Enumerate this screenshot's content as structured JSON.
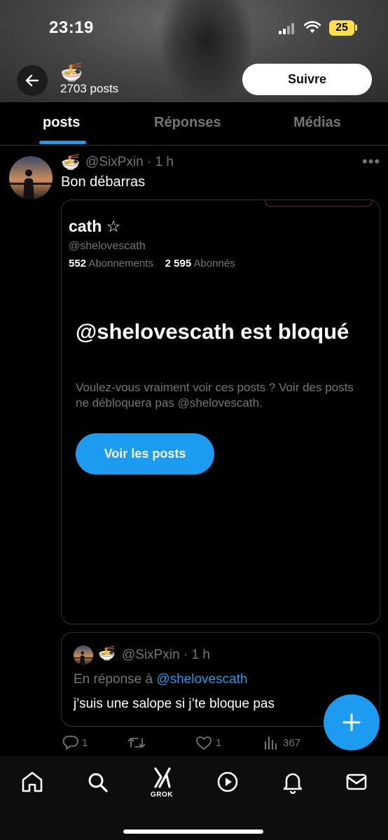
{
  "status_bar": {
    "time": "23:19",
    "battery": "25"
  },
  "header": {
    "emoji": "🍜",
    "post_count": "2703 posts",
    "follow_label": "Suivre"
  },
  "tabs": [
    {
      "label": "posts",
      "active": true
    },
    {
      "label": "Réponses",
      "active": false
    },
    {
      "label": "Médias",
      "active": false
    }
  ],
  "post": {
    "author_emoji": "🍜",
    "author_line": "@SixPxin · 1 h",
    "text": "Bon débarras",
    "embedded_profile": {
      "name": "cath ☆",
      "handle": "@shelovescath",
      "following_count": "552",
      "following_label": "Abonnements",
      "followers_count": "2 595",
      "followers_label": "Abonnés",
      "blocked_title": "@shelovescath est bloqué",
      "blocked_desc": "Voulez-vous vraiment voir ces posts ? Voir des posts ne débloquera pas @shelovescath.",
      "view_posts_label": "Voir les posts"
    },
    "quoted": {
      "emoji": "🍜",
      "author_line": "@SixPxin · 1 h",
      "reply_prefix": "En réponse à",
      "reply_to": "@shelovescath",
      "text": "j’suis une salope si j’te bloque pas"
    },
    "actions": {
      "replies": "1",
      "likes": "1",
      "views": "367"
    }
  },
  "nav": {
    "grok_label": "GROK"
  },
  "colors": {
    "accent": "#1d9bf0",
    "muted": "#71767b",
    "background": "#000000"
  }
}
